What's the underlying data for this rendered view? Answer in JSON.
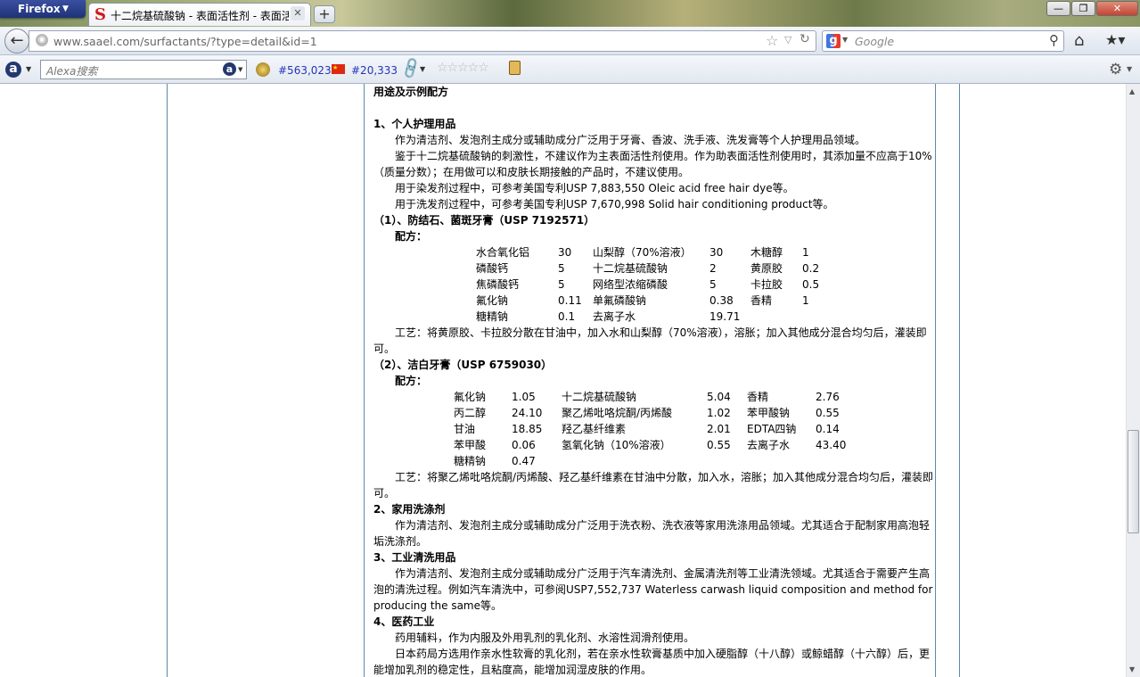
{
  "browser": {
    "menu_label": "Firefox",
    "tab_title": "十二烷基硫酸钠 - 表面活性剂 - 表面活...",
    "tab_favicon": "S",
    "new_tab": "+",
    "url": "www.saael.com/surfactants/?type=detail&id=1",
    "search_placeholder": "Google",
    "win_min": "—",
    "win_max": "❐",
    "win_close": "✕"
  },
  "alexa": {
    "search_placeholder": "Alexa搜索",
    "global_rank": "#563,023",
    "country_rank": "#20,333",
    "stars": "☆☆☆☆☆"
  },
  "article": {
    "heading": "用途及示例配方",
    "s1_title": "1、个人护理用品",
    "s1_p1": "作为清洁剂、发泡剂主成分或辅助成分广泛用于牙膏、香波、洗手液、洗发膏等个人护理用品领域。",
    "s1_p2": "鉴于十二烷基硫酸钠的刺激性，不建议作为主表面活性剂使用。作为助表面活性剂使用时，其添加量不应高于10%（质量分数）；在用做可以和皮肤长期接触的产品时，不建议使用。",
    "s1_p3": "用于染发剂过程中，可参考美国专利USP 7,883,550 Oleic acid free hair dye等。",
    "s1_p4": "用于洗发剂过程中，可参考美国专利USP 7,670,998 Solid hair conditioning product等。",
    "f1_title": "（1）、防结石、菌斑牙膏（USP 7192571）",
    "f1_label": "配方：",
    "f1_rows": [
      [
        "水合氧化铝",
        "30",
        "山梨醇（70%溶液）",
        "30",
        "木糖醇",
        "1"
      ],
      [
        "磷酸钙",
        "5",
        "十二烷基硫酸钠",
        "2",
        "黄原胶",
        "0.2"
      ],
      [
        "焦磷酸钙",
        "5",
        "网络型浓缩磷酸",
        "5",
        "卡拉胶",
        "0.5"
      ],
      [
        "氟化钠",
        "0.11",
        "单氟磷酸钠",
        "0.38",
        "香精",
        "1"
      ],
      [
        "糖精钠",
        "0.1",
        "去离子水",
        "19.71",
        "",
        ""
      ]
    ],
    "f1_process": "工艺：将黄原胶、卡拉胶分散在甘油中，加入水和山梨醇（70%溶液），溶胀；加入其他成分混合均匀后，灌装即可。",
    "f2_title": "（2）、洁白牙膏（USP 6759030）",
    "f2_label": "配方：",
    "f2_rows": [
      [
        "氟化钠",
        "1.05",
        "十二烷基硫酸钠",
        "5.04",
        "香精",
        "2.76"
      ],
      [
        "丙二醇",
        "24.10",
        "聚乙烯吡咯烷酮/丙烯酸",
        "1.02",
        "苯甲酸钠",
        "0.55"
      ],
      [
        "甘油",
        "18.85",
        "羟乙基纤维素",
        "2.01",
        "EDTA四钠",
        "0.14"
      ],
      [
        "苯甲酸",
        "0.06",
        "氢氧化钠（10%溶液）",
        "0.55",
        "去离子水",
        "43.40"
      ],
      [
        "糖精钠",
        "0.47",
        "",
        "",
        "",
        ""
      ]
    ],
    "f2_process": "工艺：将聚乙烯吡咯烷酮/丙烯酸、羟乙基纤维素在甘油中分散，加入水，溶胀；加入其他成分混合均匀后，灌装即可。",
    "s2_title": "2、家用洗涤剂",
    "s2_p1": "作为清洁剂、发泡剂主成分或辅助成分广泛用于洗衣粉、洗衣液等家用洗涤用品领域。尤其适合于配制家用高泡轻垢洗涤剂。",
    "s3_title": "3、工业清洗用品",
    "s3_p1": "作为清洁剂、发泡剂主成分或辅助成分广泛用于汽车清洗剂、金属清洗剂等工业清洗领域。尤其适合于需要产生高泡的清洗过程。例如汽车清洗中，可参阅USP7,552,737 Waterless carwash liquid composition and method for producing the same等。",
    "s4_title": "4、医药工业",
    "s4_p1": "药用辅料，作为内服及外用乳剂的乳化剂、水溶性润滑剂使用。",
    "s4_p2": "日本药局方选用作亲水性软膏的乳化剂，若在亲水性软膏基质中加入硬脂醇（十八醇）或鲸蜡醇（十六醇）后，更能增加乳剂的稳定性，且粘度高，能增加润湿皮肤的作用。"
  }
}
